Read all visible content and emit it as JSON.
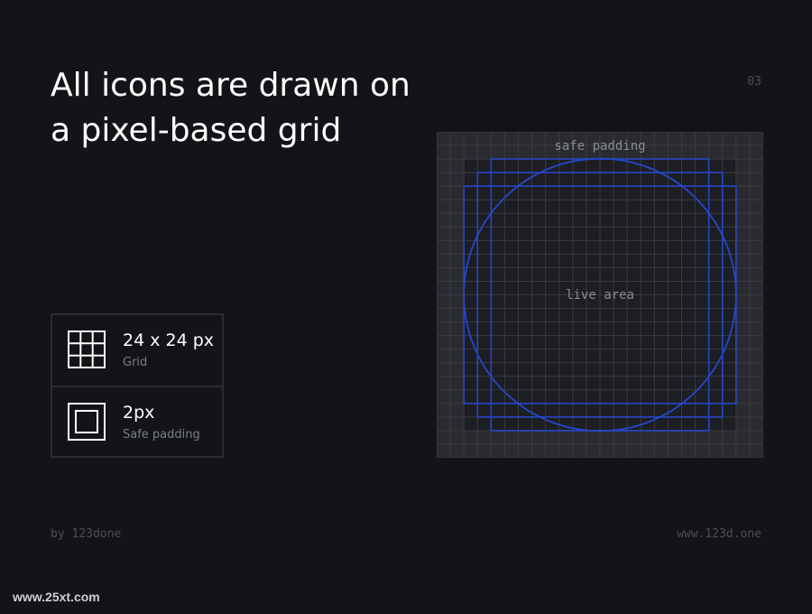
{
  "header": {
    "title": "All icons are drawn on a pixel-based grid",
    "page_number": "03"
  },
  "specs": [
    {
      "value": "24 x 24 px",
      "label": "Grid",
      "icon": "grid-icon"
    },
    {
      "value": "2px",
      "label": "Safe padding",
      "icon": "padding-square-icon"
    }
  ],
  "diagram": {
    "grid_cells": 24,
    "top_label": "safe padding",
    "center_label": "live area",
    "colors": {
      "background": "#2a2b30",
      "grid_line": "#3a3b41",
      "live_area": "#1d1e23",
      "keyline": "#2647c9"
    }
  },
  "footer": {
    "left": "by 123done",
    "right": "www.123d.one"
  },
  "watermark": "www.25xt.com"
}
